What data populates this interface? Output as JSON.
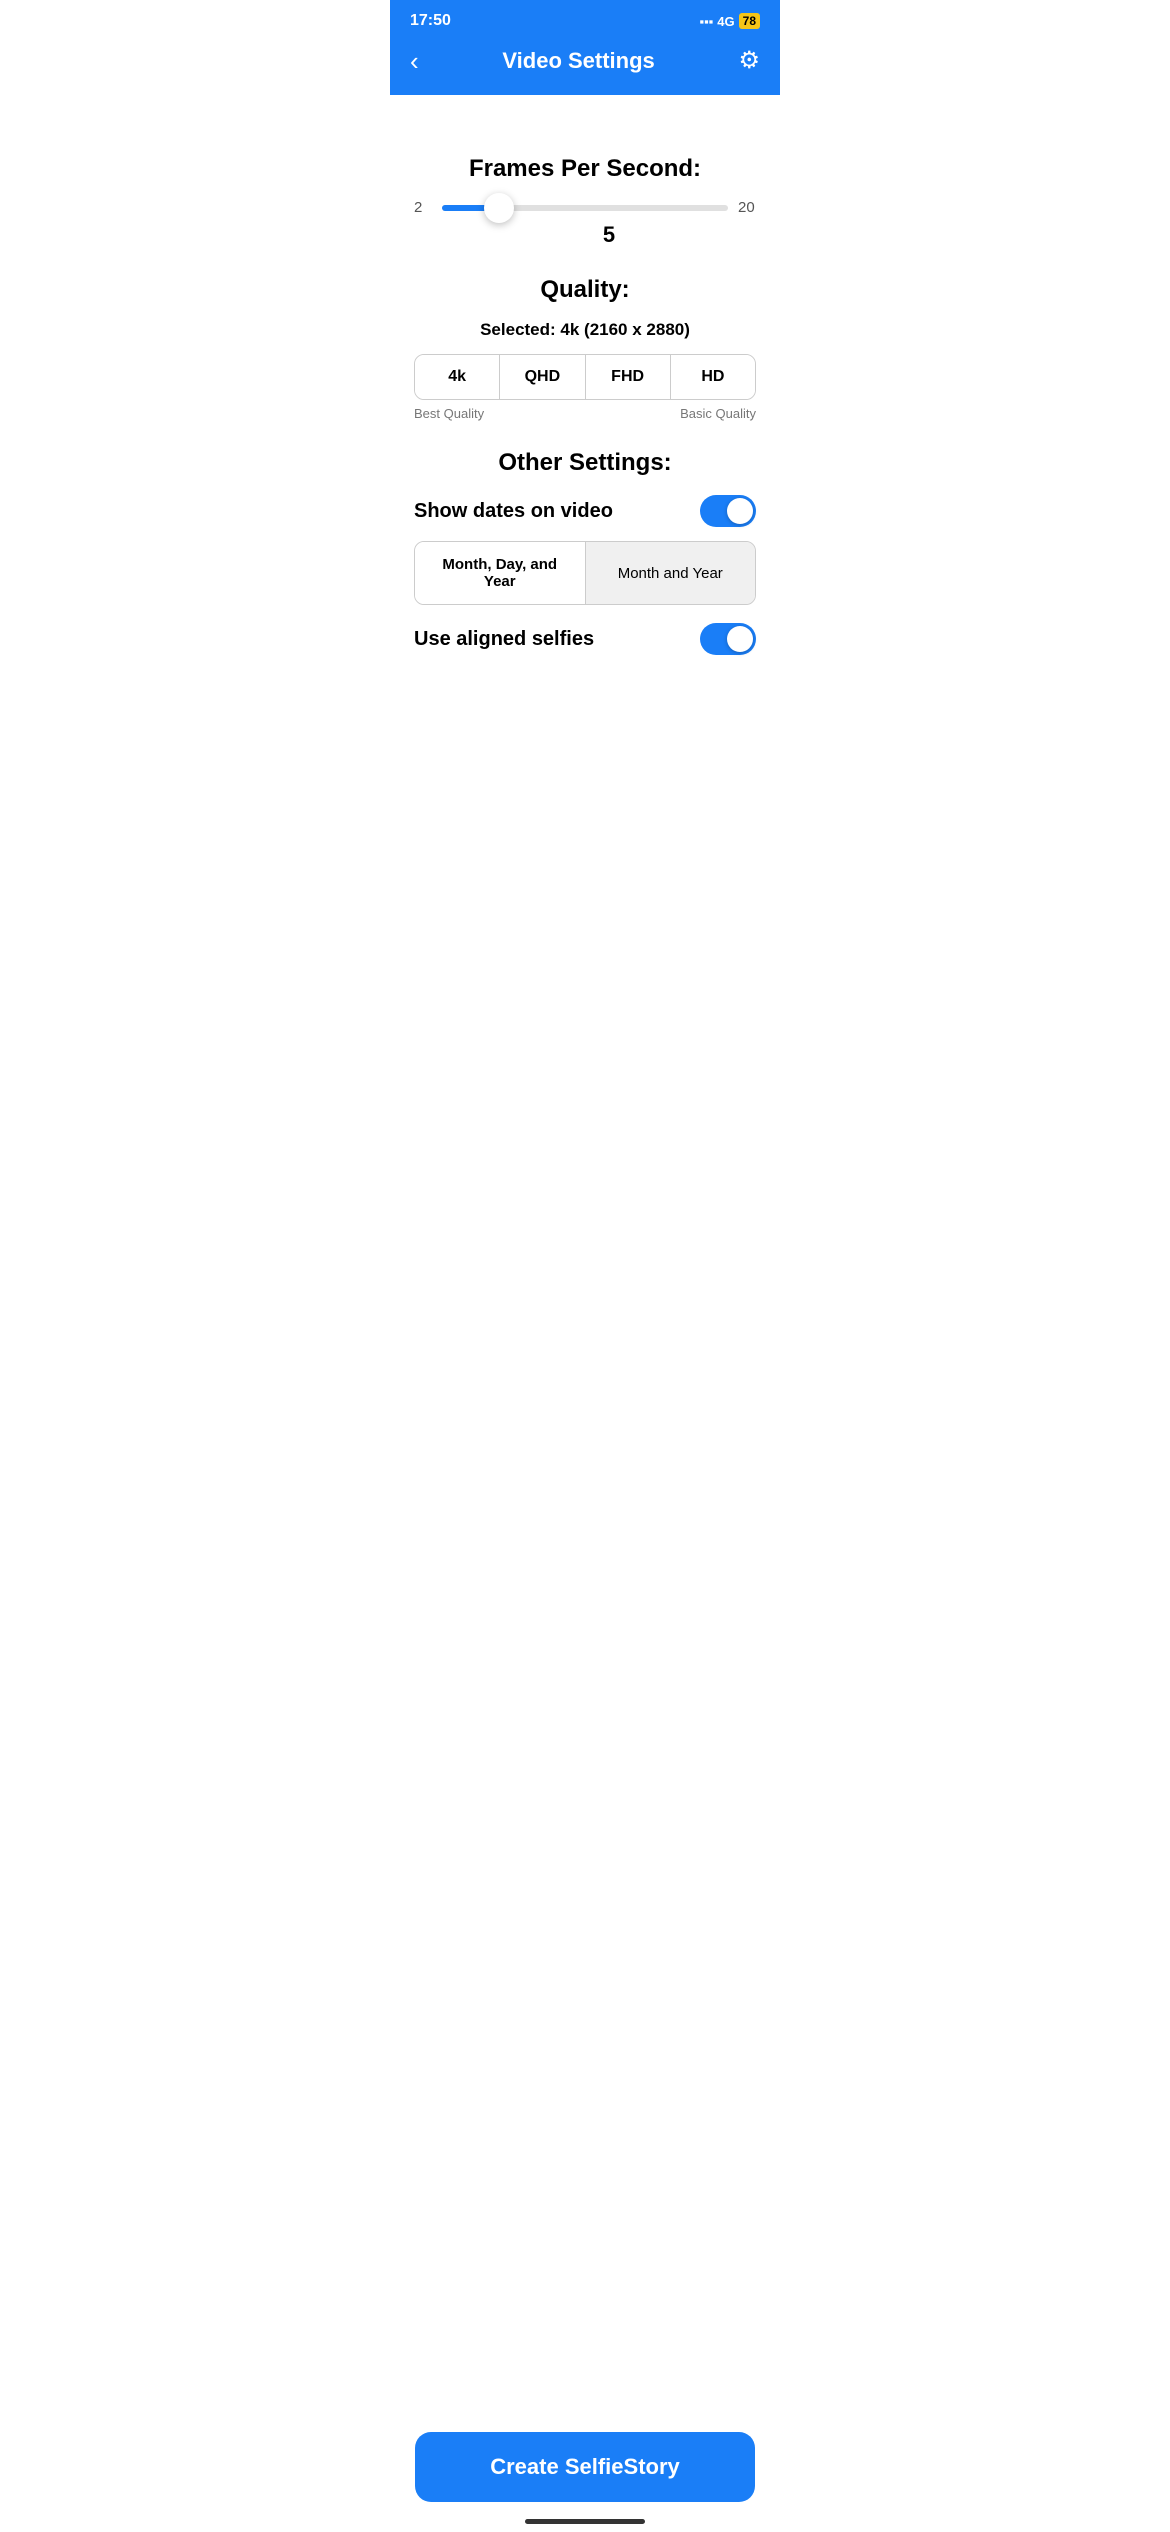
{
  "statusBar": {
    "time": "17:50",
    "network": "4G",
    "battery": "78"
  },
  "header": {
    "title": "Video Settings",
    "backLabel": "‹",
    "gearLabel": "⚙"
  },
  "framesSection": {
    "title": "Frames Per Second:",
    "min": "2",
    "max": "20",
    "value": "5",
    "sliderPercent": 20
  },
  "qualitySection": {
    "title": "Quality:",
    "selected": "Selected: 4k (2160 x 2880)",
    "options": [
      "4k",
      "QHD",
      "FHD",
      "HD"
    ],
    "activeIndex": 0,
    "bestLabel": "Best Quality",
    "basicLabel": "Basic Quality"
  },
  "otherSettings": {
    "title": "Other Settings:",
    "showDates": {
      "label": "Show dates on video",
      "enabled": true
    },
    "dateFormat": {
      "options": [
        "Month, Day, and Year",
        "Month and Year"
      ],
      "activeIndex": 0
    },
    "alignedSelfies": {
      "label": "Use aligned selfies",
      "enabled": true
    }
  },
  "createButton": {
    "label": "Create SelfieStory"
  }
}
